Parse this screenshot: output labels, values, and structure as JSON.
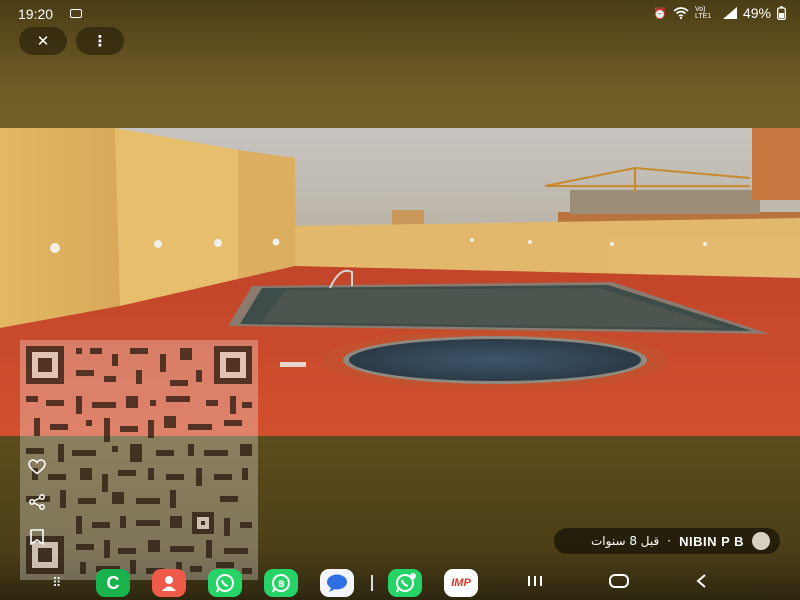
{
  "status_bar": {
    "time": "19:20",
    "signal_text": "Vo) LTE1",
    "battery": "49%"
  },
  "top_controls": {
    "close_symbol": "✕",
    "menu_symbol": "⋮"
  },
  "photo": {
    "subject": "rooftop-swimming-pool"
  },
  "side_actions": {
    "like_icon": "heart-icon",
    "share_icon": "share-icon",
    "save_icon": "bookmark-icon"
  },
  "author": {
    "name": "NIBIN P B",
    "separator": "·",
    "time_ago": "قبل 8 سنوات"
  },
  "dock": {
    "apps": [
      "phone-app",
      "contacts-app",
      "whatsapp-app",
      "whatsapp-business-app",
      "messages-app",
      "whatsapp-clone-app",
      "imp-app"
    ],
    "imp_label": "IMP"
  },
  "colors": {
    "pool_deck": "#cf4a2a",
    "wall": "#e8c174",
    "pool_water": "#3a4a50",
    "whatsapp_green": "#25d366"
  }
}
